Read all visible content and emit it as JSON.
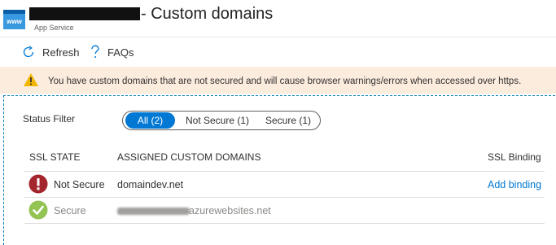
{
  "header": {
    "title_suffix": "- Custom domains",
    "subtitle": "App Service",
    "app_icon_text": "www"
  },
  "toolbar": {
    "refresh_label": "Refresh",
    "faqs_label": "FAQs"
  },
  "banner": {
    "message": "You have custom domains that are not secured and will cause browser warnings/errors when accessed over https."
  },
  "filter": {
    "label": "Status Filter",
    "options": [
      "All (2)",
      "Not Secure (1)",
      "Secure (1)"
    ],
    "selected": "All (2)"
  },
  "table": {
    "columns": [
      "SSL STATE",
      "ASSIGNED CUSTOM DOMAINS",
      "SSL Binding"
    ],
    "rows": [
      {
        "status": "Not Secure",
        "domain": "domaindev.net",
        "binding_action": "Add binding"
      },
      {
        "status": "Secure",
        "domain_visible_suffix": "azurewebsites.net"
      }
    ]
  },
  "colors": {
    "accent": "#0078d4",
    "warning_banner": "#fcecde",
    "error_red": "#a4262c",
    "success_green": "#92c353"
  }
}
